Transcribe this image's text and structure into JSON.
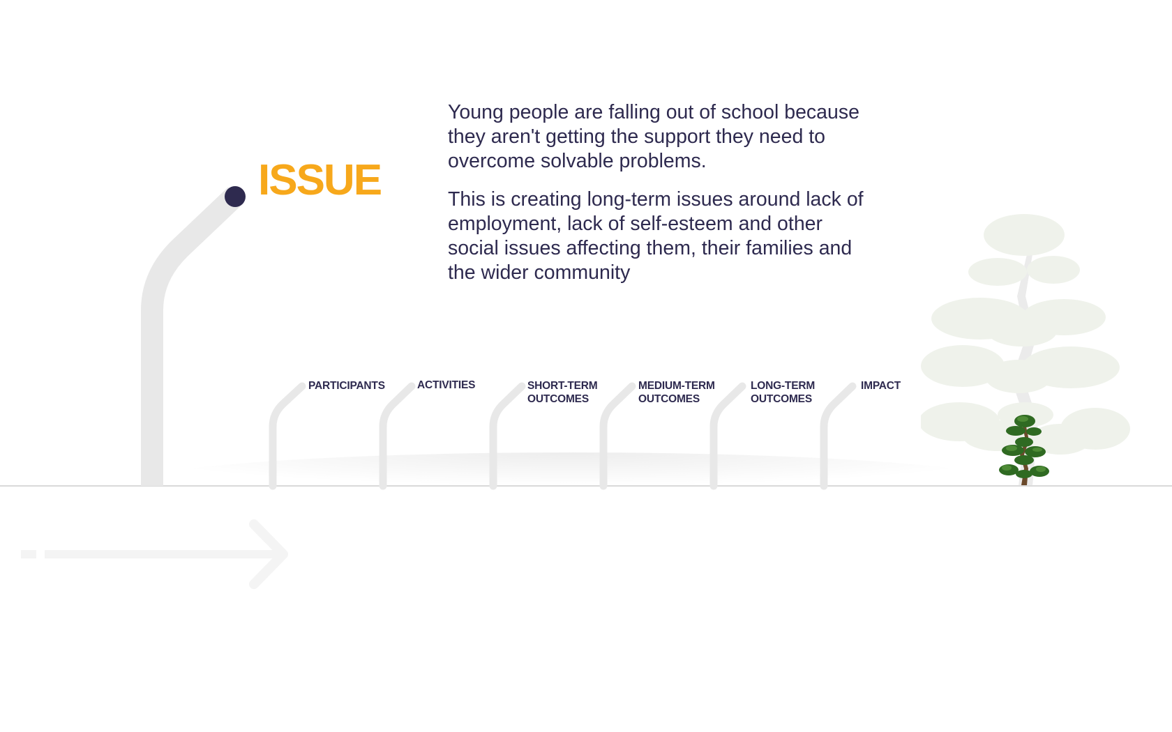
{
  "colors": {
    "dark": "#2e2a4f",
    "accent": "#f7a81b",
    "stem": "#e8e8e8",
    "ground": "#d9d9d9",
    "arrow": "#f4f4f4",
    "tree_light": "#dfe6d8",
    "tree_dark": "#2f6a22"
  },
  "issue": {
    "title": "ISSUE",
    "paragraph_1": "Young people are falling out of school because they aren't getting the support they need to overcome solvable problems.",
    "paragraph_2": "This is creating long-term issues around lack of employment, lack of self-esteem and other social issues affecting them, their families and the wider community"
  },
  "stages": [
    {
      "label": "PARTICIPANTS"
    },
    {
      "label": "ACTIVITIES"
    },
    {
      "label": "SHORT-TERM\nOUTCOMES"
    },
    {
      "label": "MEDIUM-TERM\nOUTCOMES"
    },
    {
      "label": "LONG-TERM\nOUTCOMES"
    },
    {
      "label": "IMPACT"
    }
  ],
  "icons": {
    "timeline_arrow": "arrow-right-icon",
    "goal_tree": "bonsai-tree-icon",
    "background_tree": "large-tree-icon"
  }
}
